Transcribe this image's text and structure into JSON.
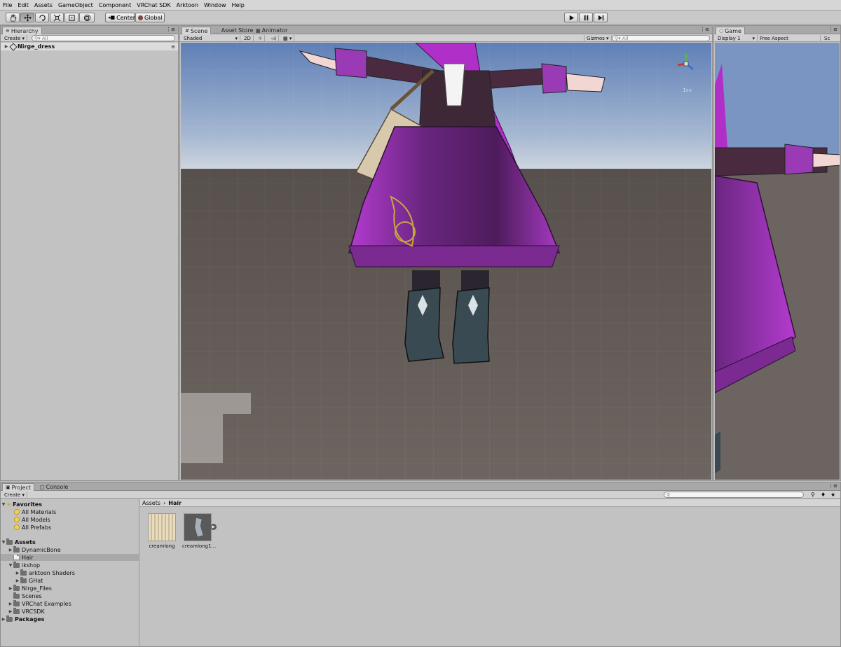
{
  "menu": [
    "File",
    "Edit",
    "Assets",
    "GameObject",
    "Component",
    "VRChat SDK",
    "Arktoon",
    "Window",
    "Help"
  ],
  "toolbar": {
    "tools": [
      "hand-tool",
      "move-tool",
      "rotate-tool",
      "scale-tool",
      "rect-tool",
      "transform-tool"
    ],
    "pivot_label": "Center",
    "space_label": "Global"
  },
  "hierarchy": {
    "tab": "Hierarchy",
    "create_label": "Create",
    "search_placeholder": "All",
    "root_item": "Nirge_dress"
  },
  "scene": {
    "tabs": [
      "Scene",
      "Asset Store",
      "Animator"
    ],
    "shading": "Shaded",
    "mode_2d": "2D",
    "gizmos_label": "Gizmos",
    "search_placeholder": "All",
    "persp_label": "Iso"
  },
  "game": {
    "tab": "Game",
    "display": "Display 1",
    "aspect": "Free Aspect",
    "scale_label": "Sc"
  },
  "project": {
    "tabs": [
      "Project",
      "Console"
    ],
    "create_label": "Create",
    "tree": [
      {
        "label": "Favorites",
        "kind": "section"
      },
      {
        "label": "All Materials",
        "kind": "search"
      },
      {
        "label": "All Models",
        "kind": "search"
      },
      {
        "label": "All Prefabs",
        "kind": "search"
      },
      {
        "label": "Assets",
        "kind": "section"
      },
      {
        "label": "DynamicBone",
        "kind": "folder"
      },
      {
        "label": "Hair",
        "kind": "folder"
      },
      {
        "label": "ikshop",
        "kind": "folder"
      },
      {
        "label": "arktoon Shaders",
        "kind": "folder"
      },
      {
        "label": "GHat",
        "kind": "folder"
      },
      {
        "label": "Nirge_Files",
        "kind": "folder"
      },
      {
        "label": "Scenes",
        "kind": "folder"
      },
      {
        "label": "VRChat Examples",
        "kind": "folder"
      },
      {
        "label": "VRCSDK",
        "kind": "folder"
      },
      {
        "label": "Packages",
        "kind": "section"
      }
    ],
    "breadcrumb": [
      "Assets",
      "Hair"
    ],
    "assets": [
      {
        "label": "creamlong"
      },
      {
        "label": "creamlong1..."
      }
    ]
  },
  "colors": {
    "dress_purple": "#8a2ea0",
    "sky_top": "#6e86b8",
    "ground": "#6a635f",
    "selection": "#a9a9a9"
  }
}
